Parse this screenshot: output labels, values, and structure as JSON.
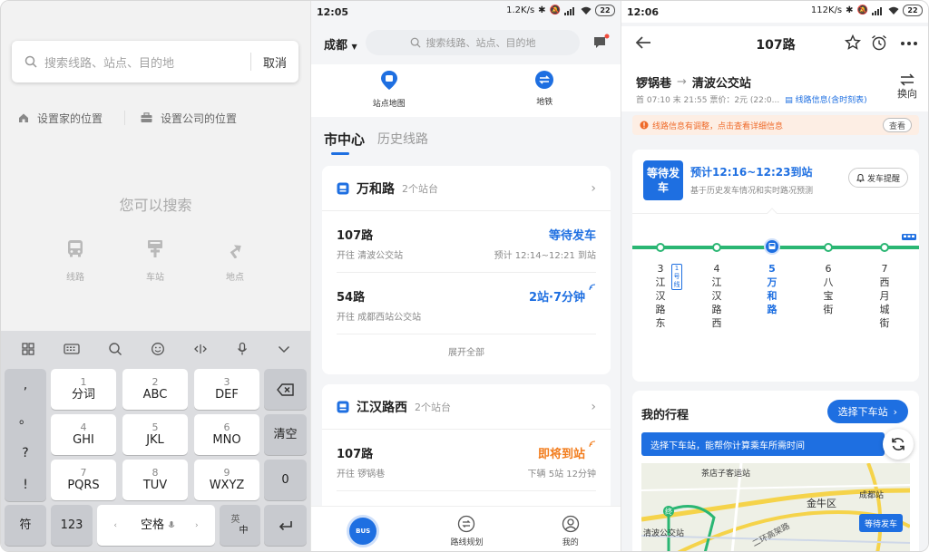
{
  "panel1": {
    "search": {
      "placeholder": "搜索线路、站点、目的地",
      "cancel": "取消"
    },
    "quick": {
      "home": "设置家的位置",
      "company": "设置公司的位置"
    },
    "hint": "您可以搜索",
    "categories": [
      {
        "label": "线路",
        "icon": "bus-icon"
      },
      {
        "label": "车站",
        "icon": "bus-stop-icon"
      },
      {
        "label": "地点",
        "icon": "turn-arrow-icon"
      }
    ],
    "keyboard": {
      "punct": [
        ",",
        "。",
        "?",
        "!"
      ],
      "keys": [
        {
          "num": "1",
          "let": "分词"
        },
        {
          "num": "2",
          "let": "ABC"
        },
        {
          "num": "3",
          "let": "DEF"
        },
        {
          "num": "4",
          "let": "GHI"
        },
        {
          "num": "5",
          "let": "JKL"
        },
        {
          "num": "6",
          "let": "MNO"
        },
        {
          "num": "7",
          "let": "PQRS"
        },
        {
          "num": "8",
          "let": "TUV"
        },
        {
          "num": "9",
          "let": "WXYZ"
        }
      ],
      "clear": "清空",
      "zero": "0",
      "symbol": "符",
      "num123": "123",
      "space": "空格",
      "lang_top": "英",
      "lang_bottom": "中"
    }
  },
  "panel2": {
    "status": {
      "time": "12:05",
      "speed": "1.2K/s",
      "battery": "22"
    },
    "city": "成都",
    "search_placeholder": "搜索线路、站点、目的地",
    "nav": [
      "站点地图",
      "地铁"
    ],
    "tabs": [
      "市中心",
      "历史线路"
    ],
    "cards": [
      {
        "name": "万和路",
        "count": "2个站台",
        "lines": [
          {
            "no": "107路",
            "dir": "开往 清波公交站",
            "status": "等待发车",
            "eta": "预计 12:14~12:21 到站"
          },
          {
            "no": "54路",
            "dir": "开往 成都西站公交站",
            "status": "2站·7分钟",
            "eta": ""
          }
        ],
        "expand": "展开全部"
      },
      {
        "name": "江汉路西",
        "count": "2个站台",
        "lines": [
          {
            "no": "107路",
            "dir": "开往 锣锅巷",
            "status": "即将到站",
            "eta": "下辆 5站 12分钟"
          }
        ]
      }
    ],
    "bottom": {
      "bus": "BUS",
      "plan": "路线规划",
      "me": "我的"
    },
    "colors": {
      "accent": "#1e6fe1",
      "orange": "#f27c1c"
    }
  },
  "panel3": {
    "status": {
      "time": "12:06",
      "speed": "112K/s",
      "battery": "22"
    },
    "title": "107路",
    "route_from": "锣锅巷",
    "route_to": "清波公交站",
    "swap": "换向",
    "meta": "首 07:10 末 21:55 票价：2元 (22:0...",
    "meta_link": "线路信息(含时刻表)",
    "notice": "线路信息有调整，点击查看详细信息",
    "notice_btn": "查看",
    "wait_badge": "等待发车",
    "eta": "预计12:16~12:23到站",
    "basis": "基于历史发车情况和实时路况预测",
    "remind": "发车提醒",
    "stops": [
      {
        "name": "3江汉路东",
        "current": false
      },
      {
        "name": "4江汉路西",
        "current": false
      },
      {
        "name": "5万和路",
        "current": true
      },
      {
        "name": "6八宝街",
        "current": false
      },
      {
        "name": "7西月城街",
        "current": false
      }
    ],
    "metro_tag": "1号线",
    "trip_label": "我的行程",
    "pick_btn": "选择下车站",
    "tip": "选择下车站，能帮你计算乘车所需时间",
    "map_labels": {
      "a": "茶店子客运站",
      "b": "金牛区",
      "c": "成都站",
      "d": "清波公交站",
      "e": "二环高架路",
      "f": "等待发车",
      "g": "终"
    },
    "colors": {
      "accent": "#1e6fe1",
      "track": "#2ab673"
    }
  }
}
